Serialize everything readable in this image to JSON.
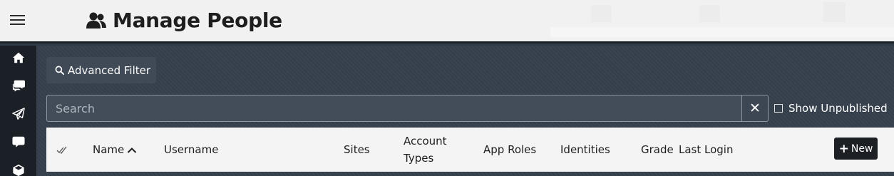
{
  "header": {
    "title": "Manage People",
    "title_icon": "people-icon",
    "menu_icon": "hamburger-icon"
  },
  "sidebar": {
    "items": [
      {
        "icon": "home-icon"
      },
      {
        "icon": "chat-bubbles-icon"
      },
      {
        "icon": "paper-plane-icon"
      },
      {
        "icon": "comment-icon"
      },
      {
        "icon": "cube-icon"
      }
    ]
  },
  "toolbar": {
    "advanced_filter_label": "Advanced Filter",
    "search_placeholder": "Search",
    "search_value": "",
    "clear_label": "✕",
    "show_unpublished_label": "Show Unpublished",
    "show_unpublished_checked": false
  },
  "table": {
    "columns": [
      {
        "key": "name",
        "label": "Name"
      },
      {
        "key": "username",
        "label": "Username"
      },
      {
        "key": "sites",
        "label": "Sites"
      },
      {
        "key": "account_types_1",
        "label": "Account"
      },
      {
        "key": "account_types_2",
        "label": "Types"
      },
      {
        "key": "app_roles",
        "label": "App Roles"
      },
      {
        "key": "identities",
        "label": "Identities"
      },
      {
        "key": "grade",
        "label": "Grade"
      },
      {
        "key": "last_login",
        "label": "Last Login"
      }
    ],
    "new_button_label": "New",
    "new_button_prefix": "+"
  },
  "colors": {
    "header_bg": "#f1f1f1",
    "sidebar_bg": "#1b2026",
    "main_bg": "#35404c",
    "table_head_bg": "#f4f4f4",
    "new_button_bg": "#1c1f24"
  }
}
